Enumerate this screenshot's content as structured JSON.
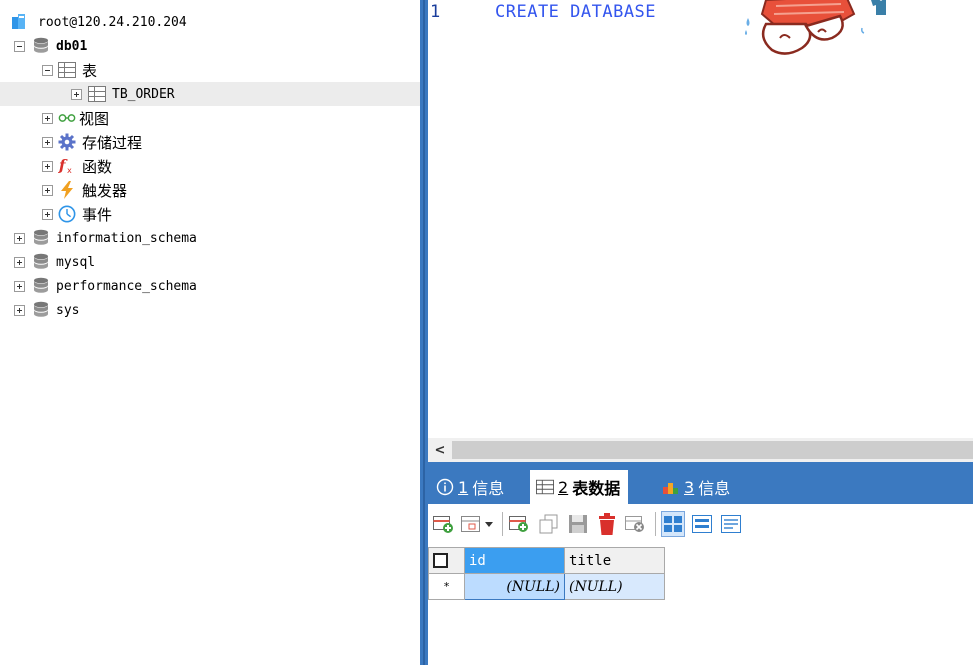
{
  "connection": {
    "label": "root@120.24.210.204"
  },
  "tree": {
    "db01": {
      "label": "db01"
    },
    "tables_folder": {
      "label": "表"
    },
    "table_tb_order": {
      "label": "TB_ORDER"
    },
    "views": {
      "label": "视图"
    },
    "procedures": {
      "label": "存储过程"
    },
    "functions": {
      "label": "函数"
    },
    "triggers": {
      "label": "触发器"
    },
    "events": {
      "label": "事件"
    },
    "other_dbs": [
      {
        "label": "information_schema"
      },
      {
        "label": "mysql"
      },
      {
        "label": "performance_schema"
      },
      {
        "label": "sys"
      }
    ]
  },
  "editor": {
    "line_number": "1",
    "code": "CREATE DATABASE"
  },
  "result_tabs": [
    {
      "num": "1",
      "label": "信息",
      "icon": "info-icon",
      "active": false
    },
    {
      "num": "2",
      "label": "表数据",
      "icon": "table-icon",
      "active": true
    },
    {
      "num": "3",
      "label": "信息",
      "icon": "stats-icon",
      "active": false
    }
  ],
  "grid": {
    "columns": [
      "id",
      "title"
    ],
    "rows": [
      {
        "marker": "*",
        "cells": [
          "(NULL)",
          "(NULL)"
        ]
      }
    ]
  },
  "colors": {
    "accent": "#3b79c0",
    "keyword": "#3355ee",
    "selected_header": "#3b9ef0"
  }
}
